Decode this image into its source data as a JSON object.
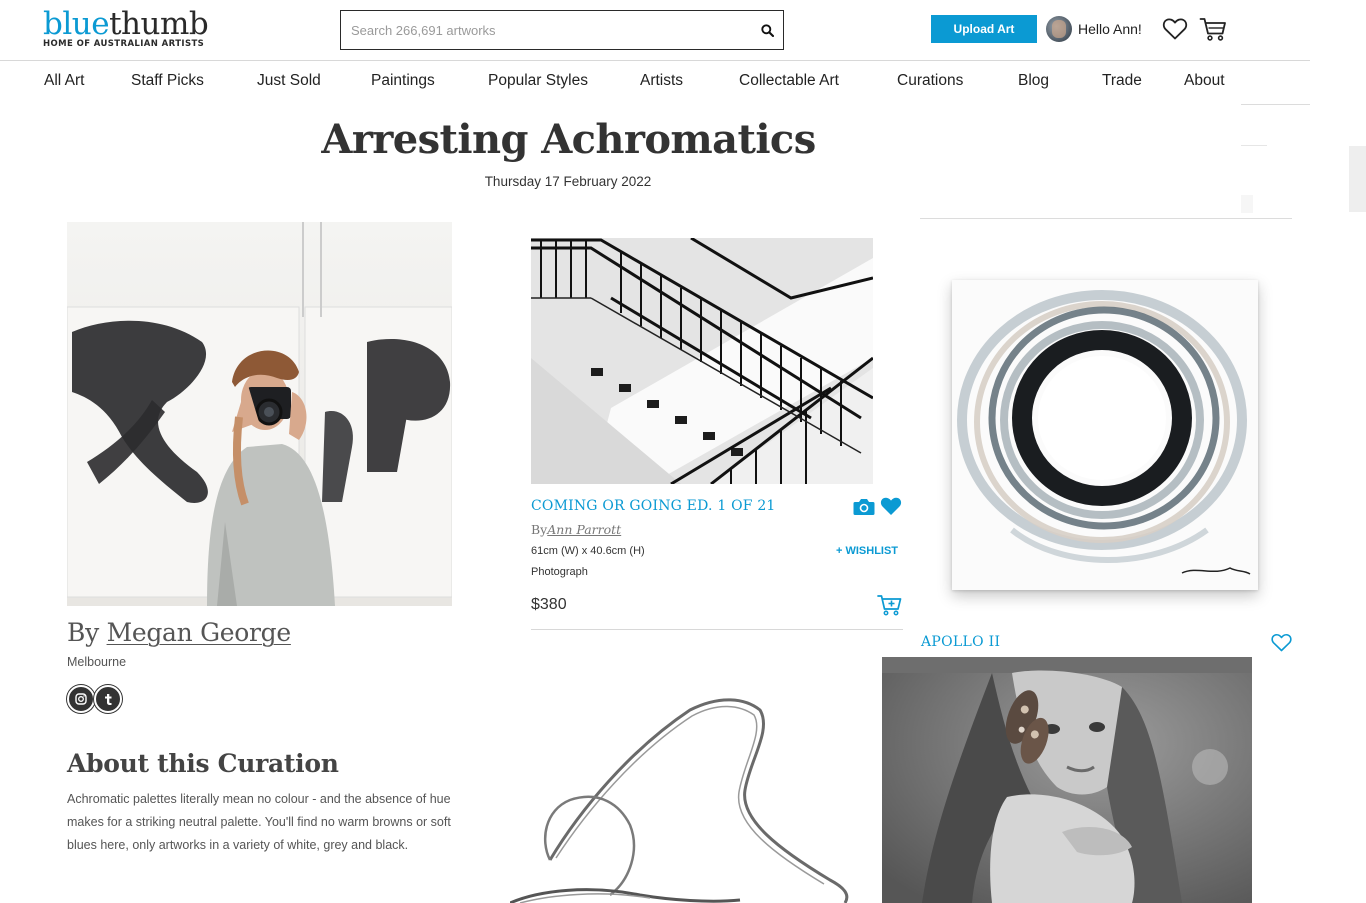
{
  "header": {
    "logo_blue": "blue",
    "logo_dark": "thumb",
    "logo_tagline": "HOME OF AUSTRALIAN ARTISTS",
    "search_placeholder": "Search 266,691 artworks",
    "search_icon": "search-icon",
    "upload_label": "Upload Art",
    "greeting": "Hello Ann!",
    "wishlist_icon": "heart-outline-icon",
    "cart_icon": "cart-icon"
  },
  "nav": {
    "items": [
      {
        "label": "All Art"
      },
      {
        "label": "Staff Picks"
      },
      {
        "label": "Just Sold"
      },
      {
        "label": "Paintings"
      },
      {
        "label": "Popular Styles"
      },
      {
        "label": "Artists"
      },
      {
        "label": "Collectable Art"
      },
      {
        "label": "Curations"
      },
      {
        "label": "Blog"
      },
      {
        "label": "Trade"
      },
      {
        "label": "About"
      }
    ]
  },
  "curation": {
    "title": "Arresting Achromatics",
    "date": "Thursday 17 February 2022",
    "by_prefix": "By",
    "curator_name": "Megan George",
    "curator_city": "Melbourne",
    "social": [
      "instagram-icon",
      "tumblr-icon"
    ],
    "about_heading": "About this Curation",
    "about_text": "Achromatic palettes literally mean no colour - and the absence of hue makes for a striking neutral palette. You'll find no warm browns or soft blues here, only artworks in a variety of white, grey and black."
  },
  "artworks": [
    {
      "title": "COMING OR GOING ED. 1 OF 21",
      "by_prefix": "By",
      "artist": "Ann Parrott",
      "dimensions": "61cm (W) x 40.6cm (H)",
      "wishlist_label": "+ WISHLIST",
      "medium": "Photograph",
      "price": "$380",
      "icons": [
        "camera-icon",
        "heart-filled-icon",
        "add-to-cart-icon"
      ]
    },
    {
      "title": "APOLLO II",
      "icons": [
        "heart-outline-icon"
      ]
    }
  ],
  "colors": {
    "accent": "#0b9ad3",
    "text": "#333333",
    "rule": "#d8d8d8"
  }
}
